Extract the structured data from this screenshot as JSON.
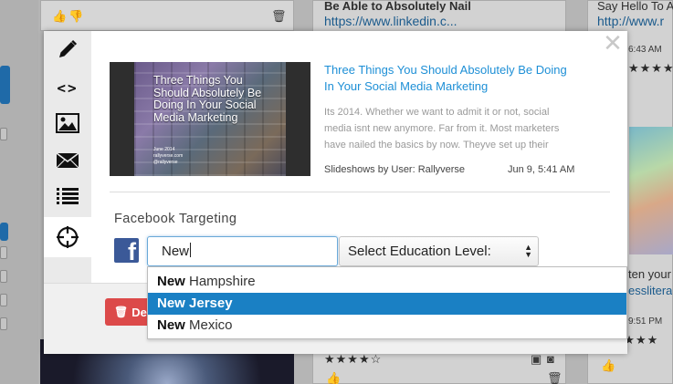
{
  "background": {
    "left_card_actions": [
      "thumbs-up-icon",
      "thumbs-down-icon",
      "trash-icon"
    ],
    "mid_card_title": "Be Able to Absolutely Nail",
    "mid_card_link": "https://www.linkedin.c...",
    "right_card_title": "Say Hello To A",
    "right_card_link": "http://www.r",
    "right_time_top": "6:43 AM",
    "right_caption_1": "ten your",
    "right_caption_2": "esslitera",
    "right_time_bottom": "9:51 PM",
    "right_stars": "★★★★★",
    "mid_stars": "★★★★☆",
    "accent_blue": "#1f6aa8"
  },
  "modal": {
    "close_label": "✕",
    "sidebar": [
      {
        "icon": "pencil-icon"
      },
      {
        "icon": "code-icon",
        "glyph": "<>"
      },
      {
        "icon": "image-icon"
      },
      {
        "icon": "envelope-icon"
      },
      {
        "icon": "list-icon"
      },
      {
        "icon": "crosshair-icon",
        "active": true
      }
    ],
    "post": {
      "thumbnail_title": "Three Things You Should Absolutely Be Doing In Your Social Media Marketing",
      "thumbnail_small": "June 2014\nrallyverse.com\n@rallyverse",
      "title": "Three Things You Should Absolutely Be Doing In Your Social Media Marketing",
      "body": "Its 2014. Whether we want to admit it or not, social media isnt new anymore. Far from it. Most marketers have nailed the basics by now. Theyve set up their",
      "meta": "Slideshows by User: Rallyverse",
      "date": "Jun 9, 5:41 AM"
    },
    "targeting": {
      "label": "Facebook Targeting",
      "location_value": "New",
      "education_select": "Select Education Level:",
      "suggestions": [
        {
          "match": "New",
          "rest": " Hampshire",
          "selected": false
        },
        {
          "match": "New",
          "rest": " Jersey",
          "selected": true
        },
        {
          "match": "New",
          "rest": " Mexico",
          "selected": false
        }
      ]
    },
    "delete_label": "Del",
    "colors": {
      "link": "#1d8fd6",
      "highlight": "#1a80c4",
      "delete": "#dc4a4a",
      "facebook": "#3b5998"
    }
  }
}
